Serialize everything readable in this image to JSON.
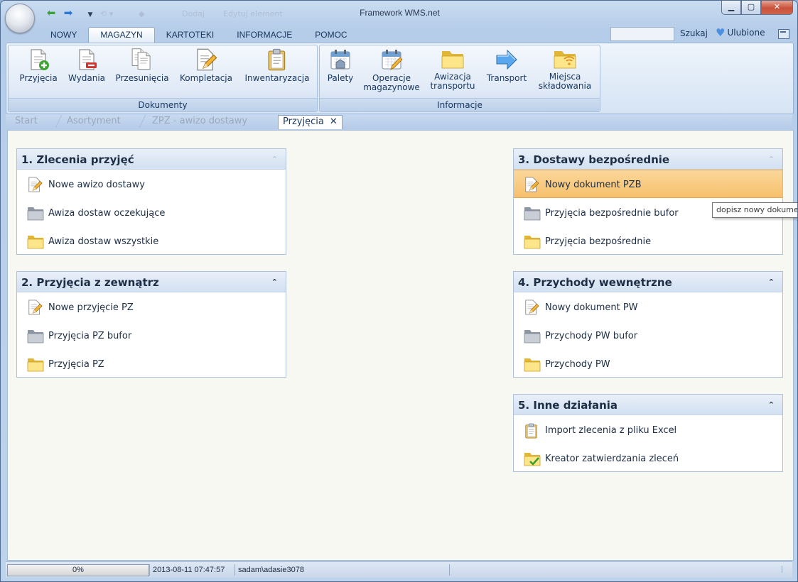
{
  "window": {
    "title": "Framework WMS.net"
  },
  "quick_access": {
    "ghost_items": [
      "Dodaj",
      "Edytuj element"
    ]
  },
  "ribbon_tabs": [
    {
      "label": "NOWY",
      "active": false
    },
    {
      "label": "MAGAZYN",
      "active": true
    },
    {
      "label": "KARTOTEKI",
      "active": false
    },
    {
      "label": "INFORMACJE",
      "active": false
    },
    {
      "label": "POMOC",
      "active": false
    }
  ],
  "search": {
    "label": "Szukaj",
    "value": ""
  },
  "favorites": {
    "label": "Ulubione"
  },
  "ribbon": {
    "groups": [
      {
        "label": "Dokumenty",
        "buttons": [
          {
            "label": "Przyjęcia",
            "icon": "doc-plus-icon"
          },
          {
            "label": "Wydania",
            "icon": "doc-minus-icon"
          },
          {
            "label": "Przesunięcia",
            "icon": "doc-stack-icon"
          },
          {
            "label": "Kompletacja",
            "icon": "doc-pencil-icon"
          },
          {
            "label": "Inwentaryzacja",
            "icon": "clipboard-icon"
          }
        ]
      },
      {
        "label": "Informacje",
        "buttons": [
          {
            "label": "Palety",
            "icon": "calendar-warehouse-icon"
          },
          {
            "label": "Operacje magazynowe",
            "line1": "Operacje",
            "line2": "magazynowe",
            "icon": "calendar-pencil-icon"
          },
          {
            "label": "Awizacja transportu",
            "line1": "Awizacja",
            "line2": "transportu",
            "icon": "folder-icon"
          },
          {
            "label": "Transport",
            "icon": "arrow-right-icon"
          },
          {
            "label": "Miejsca składowania",
            "line1": "Miejsca",
            "line2": "składowania",
            "icon": "folder-rss-icon"
          }
        ]
      }
    ]
  },
  "breadcrumbs": {
    "items": [
      "Start",
      "Asortyment",
      "ZPZ - awizo dostawy"
    ],
    "active": "Przyjęcia",
    "close_glyph": "✕"
  },
  "panels": {
    "p1": {
      "title": "1. Zlecenia przyjęć",
      "items": [
        {
          "label": "Nowe awizo dostawy",
          "icon": "doc-pencil-icon"
        },
        {
          "label": "Awiza dostaw oczekujące",
          "icon": "gray-folder-icon"
        },
        {
          "label": "Awiza dostaw wszystkie",
          "icon": "yellow-folder-icon"
        }
      ]
    },
    "p2": {
      "title": "2. Przyjęcia z zewnątrz",
      "items": [
        {
          "label": "Nowe przyjęcie PZ",
          "icon": "doc-pencil-icon"
        },
        {
          "label": "Przyjęcia PZ bufor",
          "icon": "gray-folder-icon"
        },
        {
          "label": "Przyjęcia PZ",
          "icon": "yellow-folder-icon"
        }
      ]
    },
    "p3": {
      "title": "3. Dostawy bezpośrednie",
      "items": [
        {
          "label": "Nowy dokument PZB",
          "icon": "doc-pencil-icon",
          "highlighted": true
        },
        {
          "label": "Przyjęcia bezpośrednie bufor",
          "icon": "gray-folder-icon"
        },
        {
          "label": "Przyjęcia bezpośrednie",
          "icon": "yellow-folder-icon"
        }
      ]
    },
    "p4": {
      "title": "4. Przychody wewnętrzne",
      "items": [
        {
          "label": "Nowy dokument PW",
          "icon": "doc-pencil-icon"
        },
        {
          "label": "Przychody PW bufor",
          "icon": "gray-folder-icon"
        },
        {
          "label": "Przychody PW",
          "icon": "yellow-folder-icon"
        }
      ]
    },
    "p5": {
      "title": "5. Inne działania",
      "items": [
        {
          "label": "Import zlecenia z pliku Excel",
          "icon": "clipboard-icon"
        },
        {
          "label": "Kreator zatwierdzania zleceń",
          "icon": "folder-check-icon"
        }
      ]
    }
  },
  "tooltip": {
    "text": "dopisz nowy dokument"
  },
  "status": {
    "progress_text": "0%",
    "progress": 0,
    "datetime": "2013-08-11 07:47:57",
    "user": "sadam\\adasie3078"
  },
  "colors": {
    "accent": "#f6c06c",
    "ribbon": "#d6e4f4",
    "content_bg": "#f7f8f2"
  }
}
